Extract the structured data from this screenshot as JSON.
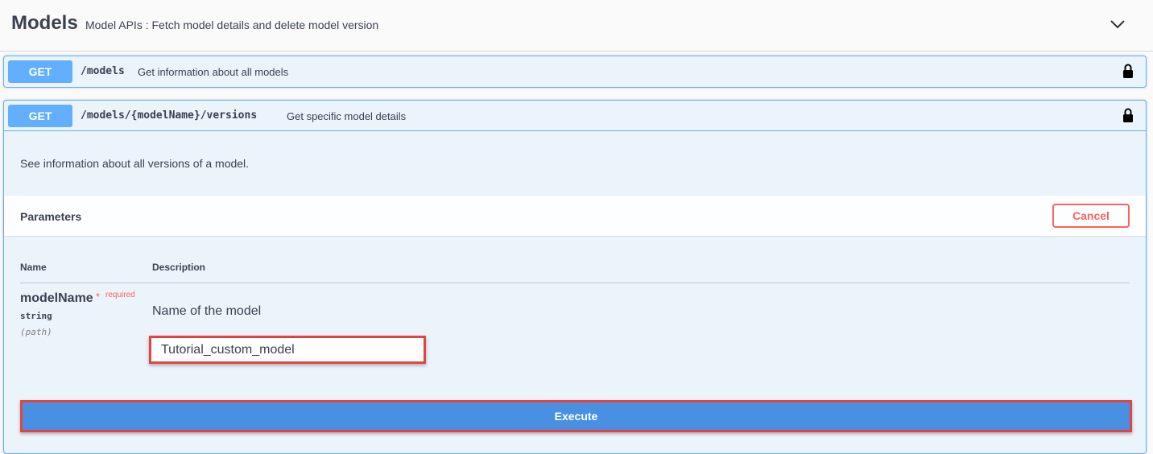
{
  "tag": {
    "title": "Models",
    "description": "Model APIs : Fetch model details and delete model version",
    "chevron_icon": "chevron-down-icon"
  },
  "operations": [
    {
      "method": "GET",
      "path": "/models",
      "summary": "Get information about all models",
      "lock_icon": "lock-icon"
    },
    {
      "method": "GET",
      "path": "/models/{modelName}/versions",
      "summary": "Get specific model details",
      "lock_icon": "lock-icon",
      "description": "See information about all versions of a model.",
      "parameters": {
        "title": "Parameters",
        "cancel_label": "Cancel",
        "columns": {
          "name": "Name",
          "description": "Description"
        },
        "items": [
          {
            "name": "modelName",
            "required_star": "*",
            "required_label": "required",
            "type": "string",
            "in": "(path)",
            "description": "Name of the model",
            "value": "Tutorial_custom_model"
          }
        ]
      },
      "execute_label": "Execute"
    }
  ],
  "colors": {
    "get_method": "#61affe",
    "execute": "#4990e2",
    "cancel": "#ff6060",
    "highlight": "#e4443f"
  }
}
